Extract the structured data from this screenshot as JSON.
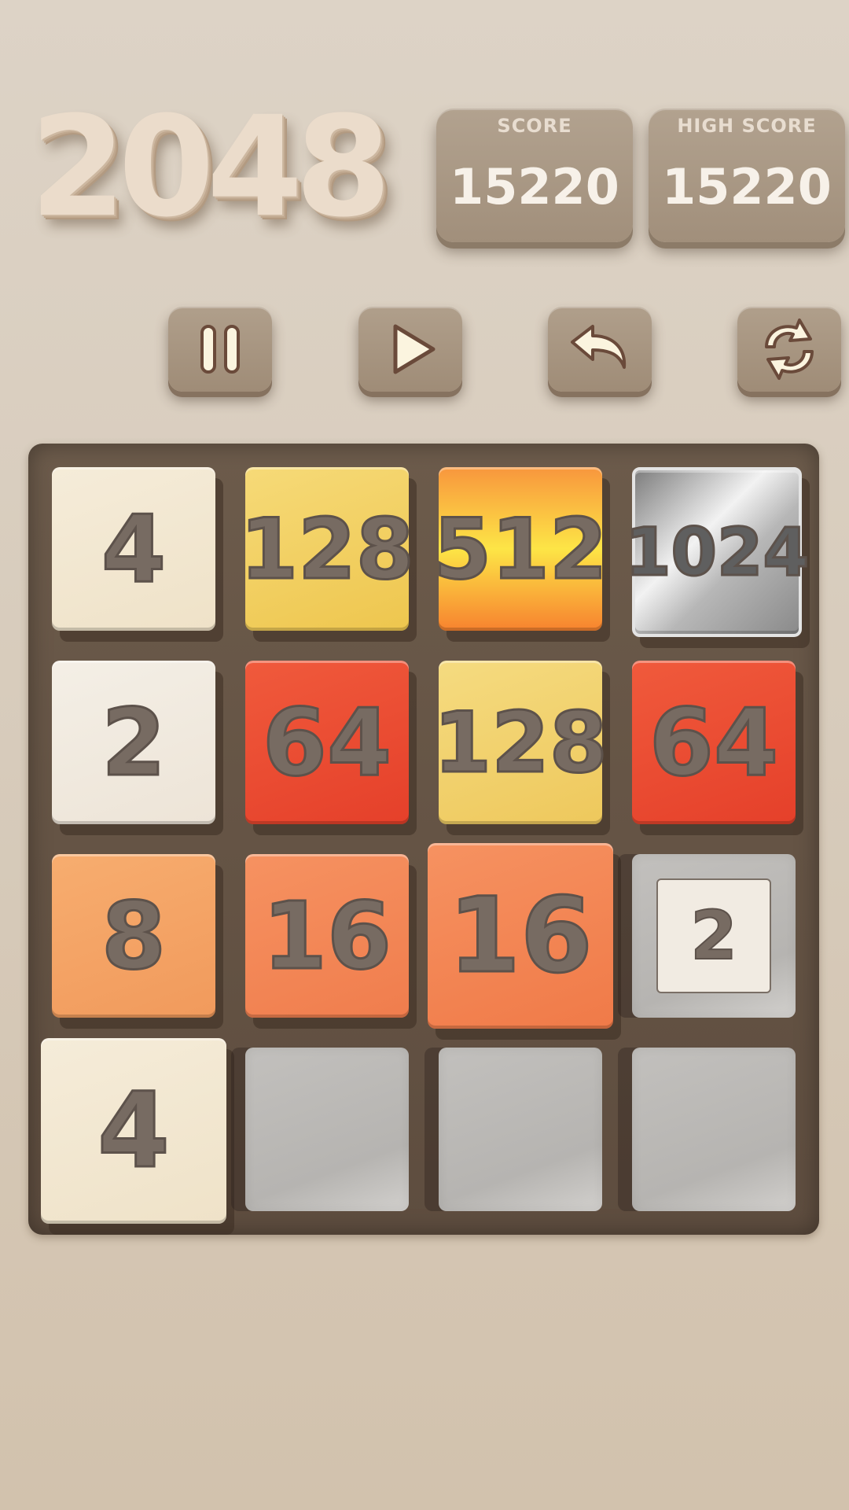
{
  "title": "2048",
  "score": {
    "label": "SCORE",
    "value": "15220"
  },
  "high_score": {
    "label": "HIGH SCORE",
    "value": "15220"
  },
  "controls": [
    {
      "name": "pause-button",
      "icon": "pause-icon"
    },
    {
      "name": "play-button",
      "icon": "play-icon"
    },
    {
      "name": "undo-button",
      "icon": "undo-icon"
    },
    {
      "name": "restart-button",
      "icon": "restart-icon"
    }
  ],
  "grid": [
    [
      "4",
      "128",
      "512",
      "1024"
    ],
    [
      "2",
      "64",
      "128",
      "64"
    ],
    [
      "8",
      "16",
      "16",
      "2"
    ],
    [
      "4",
      "",
      "",
      ""
    ]
  ],
  "colors": {
    "background": "#d8ccbd",
    "board": "#665444",
    "tile_text": "#776b62",
    "tile_2": "#f1ebe2",
    "tile_4": "#f3e8d2",
    "tile_8": "#f3a467",
    "tile_16": "#f4875a",
    "tile_64": "#ea4a2d",
    "tile_128": "#f0cf66",
    "tile_512": "#f8b23a",
    "tile_1024": "#c9c9c9",
    "empty_cell": "#bebcb9"
  }
}
